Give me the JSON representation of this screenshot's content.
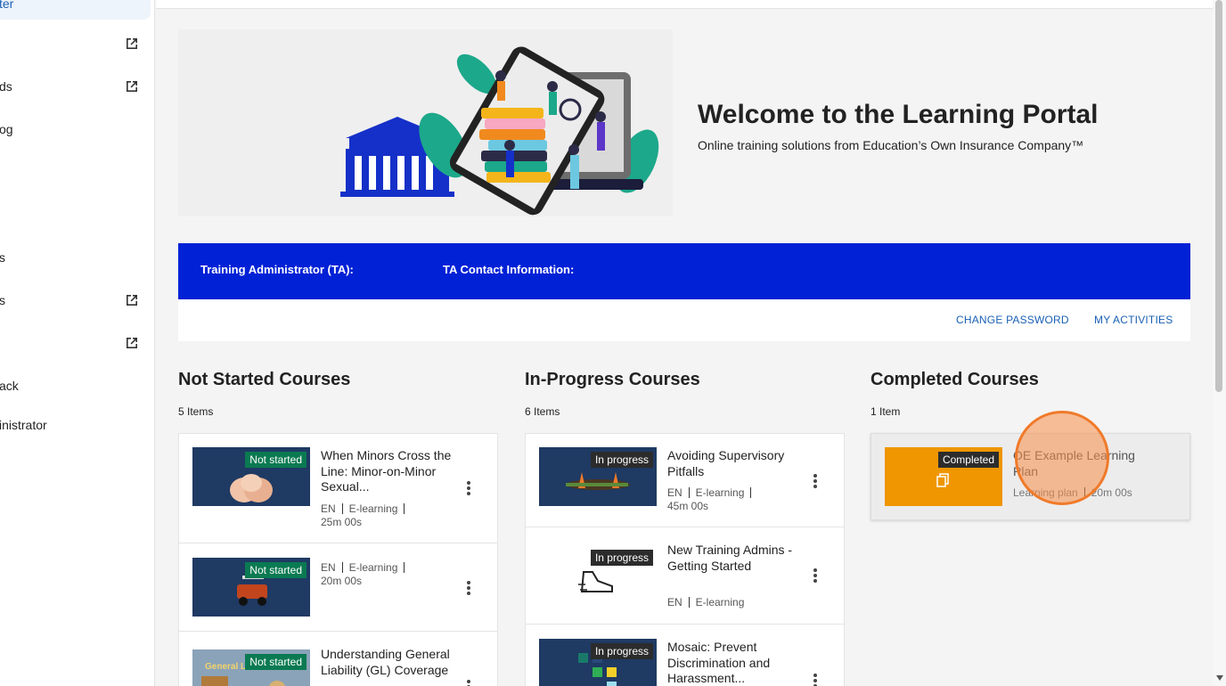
{
  "sidebar": {
    "items": [
      {
        "label": "ter",
        "active": true
      },
      {
        "label": "",
        "external": true
      },
      {
        "label": "ds",
        "external": true
      },
      {
        "label": "og",
        "external": false
      },
      {
        "label": "s",
        "external": false
      },
      {
        "label": "s",
        "external": true
      },
      {
        "label": "",
        "external": true
      },
      {
        "label": "ack",
        "external": false
      },
      {
        "label": "inistrator",
        "external": false
      }
    ]
  },
  "welcome": {
    "title": "Welcome to the Learning Portal",
    "subtitle": "Online training solutions from Education’s Own Insurance Company™"
  },
  "ta": {
    "admin_label": "Training Administrator (TA):",
    "contact_label": "TA Contact Information:",
    "change_password": "CHANGE PASSWORD",
    "my_activities": "MY ACTIVITIES"
  },
  "columns": {
    "not_started": {
      "title": "Not Started Courses",
      "count": "5 Items",
      "cards": [
        {
          "badge": "Not started",
          "title": "When Minors Cross the Line: Minor-on-Minor Sexual...",
          "lang": "EN",
          "type": "E-learning",
          "duration": "25m 00s"
        },
        {
          "badge": "Not started",
          "title": "",
          "lang": "EN",
          "type": "E-learning",
          "duration": "20m 00s"
        },
        {
          "badge": "Not started",
          "title": "Understanding General Liability (GL) Coverage",
          "thumb_text": "General Liab"
        }
      ]
    },
    "in_progress": {
      "title": "In-Progress Courses",
      "count": "6 Items",
      "cards": [
        {
          "badge": "In progress",
          "title": "Avoiding Supervisory Pitfalls",
          "lang": "EN",
          "type": "E-learning",
          "duration": "45m 00s"
        },
        {
          "badge": "In progress",
          "title": "New Training Admins - Getting Started",
          "lang": "EN",
          "type": "E-learning"
        },
        {
          "badge": "In progress",
          "title": "Mosaic: Prevent Discrimination and Harassment..."
        }
      ]
    },
    "completed": {
      "title": "Completed Courses",
      "count": "1 Item",
      "cards": [
        {
          "badge": "Completed",
          "title": "OE Example Learning Plan",
          "type": "Learning plan",
          "duration": "20m 00s"
        }
      ]
    }
  },
  "colors": {
    "brand_blue": "#0021d6",
    "link_blue": "#1a5fb4",
    "not_started_green": "#0a7a52",
    "thumb_navy": "#1f3a63",
    "completed_orange": "#ef9600",
    "cursor_orange": "#f07a2a"
  },
  "icons": {
    "external_link": "external-link-icon",
    "kebab": "more-vertical-icon",
    "learning_plan": "copy-icon"
  }
}
